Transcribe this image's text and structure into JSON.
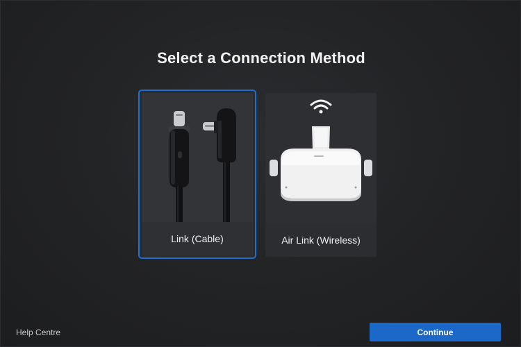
{
  "page": {
    "title": "Select a Connection Method"
  },
  "options": [
    {
      "label": "Link (Cable)",
      "icon": "usb-c-cable-icon",
      "selected": true
    },
    {
      "label": "Air Link (Wireless)",
      "icon": "vr-headset-icon",
      "selected": false
    }
  ],
  "footer": {
    "help_label": "Help Centre",
    "continue_label": "Continue"
  },
  "colors": {
    "accent": "#1c68c9",
    "selected_border": "#1f6fd1",
    "background": "#232426",
    "card": "#2e2f32"
  }
}
